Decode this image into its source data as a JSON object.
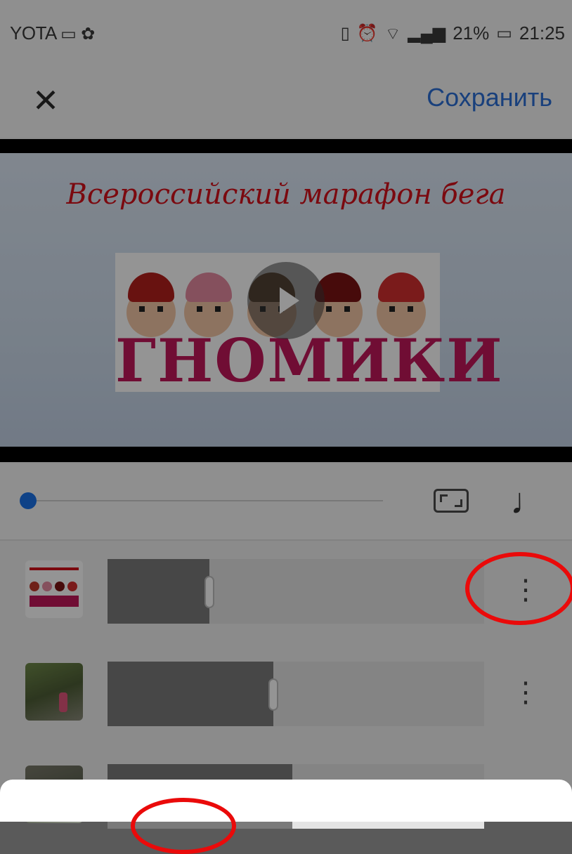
{
  "status_bar": {
    "carrier": "YOTA",
    "battery_percent": "21%",
    "time": "21:25",
    "icons": [
      "sim-card-icon",
      "notification-icon",
      "vibrate-icon",
      "alarm-icon",
      "wifi-icon",
      "signal-icon",
      "battery-icon"
    ]
  },
  "app_bar": {
    "close_icon": "close-icon",
    "save_label": "Сохранить"
  },
  "preview": {
    "title": "Всероссийский марафон бега",
    "logo_text": "ГНОМИКИ",
    "play_icon": "play-icon"
  },
  "controls": {
    "progress": 0,
    "aspect_icon": "aspect-ratio-icon",
    "music_icon": "music-note-icon"
  },
  "clips": [
    {
      "thumb": "gnomes-logo-thumbnail",
      "fill": 0.27,
      "menu_icon": "more-vert-icon",
      "highlighted": true
    },
    {
      "thumb": "park-photo-thumbnail",
      "fill": 0.44,
      "menu_icon": "more-vert-icon",
      "highlighted": false
    },
    {
      "thumb": "street-photo-thumbnail",
      "fill": 0.49,
      "menu_icon": "more-vert-icon",
      "highlighted": false
    }
  ],
  "colors": {
    "accent": "#1a73e8",
    "save_text": "#2b6fd6",
    "annotation": "#ea0a0a",
    "title_red": "#d4111b",
    "logo_magenta": "#c2185b"
  }
}
